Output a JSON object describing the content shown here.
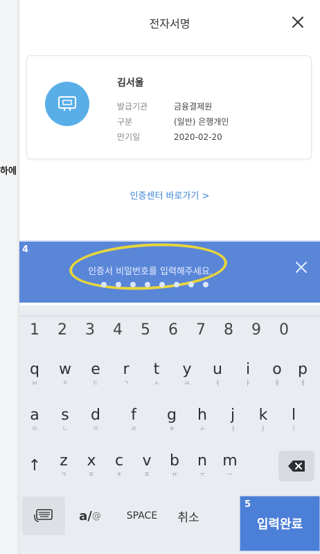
{
  "background_peek_text": "하에",
  "header": {
    "title": "전자서명"
  },
  "certificate": {
    "name": "김서울",
    "rows": [
      {
        "label": "발급기관",
        "value": "금융결제원"
      },
      {
        "label": "구분",
        "value": "(일반) 은행개인"
      },
      {
        "label": "만기일",
        "value": "2020-02-20"
      }
    ]
  },
  "center_link": "인증센터 바로가기 >",
  "password": {
    "prompt": "인증서 비밀번호를 입력해주세요.",
    "dots_entered": 8,
    "step_badge": "4"
  },
  "keyboard": {
    "numbers": [
      "1",
      "2",
      "3",
      "4",
      "5",
      "6",
      "7",
      "8",
      "9",
      "0"
    ],
    "row1": [
      {
        "main": "q",
        "sub": "ㅂ"
      },
      {
        "main": "w",
        "sub": "ㅈ"
      },
      {
        "main": "e",
        "sub": "ㄷ"
      },
      {
        "main": "r",
        "sub": "ㄱ"
      },
      {
        "main": "t",
        "sub": "ㅅ"
      },
      {
        "main": "y",
        "sub": "ㅛ"
      },
      {
        "main": "u",
        "sub": "ㅕ"
      },
      {
        "main": "i",
        "sub": "ㅑ"
      },
      {
        "main": "o",
        "sub": "ㅐ"
      },
      {
        "main": "p",
        "sub": "ㅔ"
      }
    ],
    "row2": [
      {
        "main": "a",
        "sub": "ㅁ"
      },
      {
        "main": "s",
        "sub": "ㄴ"
      },
      {
        "main": "d",
        "sub": "ㅇ"
      },
      {
        "main": "f",
        "sub": "ㄹ"
      },
      {
        "main": "g",
        "sub": "ㅎ"
      },
      {
        "main": "h",
        "sub": "ㅗ"
      },
      {
        "main": "j",
        "sub": "ㅓ"
      },
      {
        "main": "k",
        "sub": "ㅏ"
      },
      {
        "main": "l",
        "sub": "ㅣ"
      }
    ],
    "row3": [
      {
        "main": "z",
        "sub": "ㅋ"
      },
      {
        "main": "x",
        "sub": "ㅌ"
      },
      {
        "main": "c",
        "sub": "ㅊ"
      },
      {
        "main": "v",
        "sub": "ㅍ"
      },
      {
        "main": "b",
        "sub": "ㅠ"
      },
      {
        "main": "n",
        "sub": "ㅜ"
      },
      {
        "main": "m",
        "sub": "ㅡ"
      }
    ],
    "shift_symbol": "↑",
    "alpha_label": "a/",
    "at_label": "@",
    "space_label": "SPACE",
    "cancel_label": "취소",
    "done_label": "입력완료",
    "done_step_badge": "5"
  },
  "colors": {
    "accent": "#5a86d8",
    "highlight": "#e8d53a",
    "cert_icon": "#5aaee8",
    "link": "#3b82d6"
  }
}
